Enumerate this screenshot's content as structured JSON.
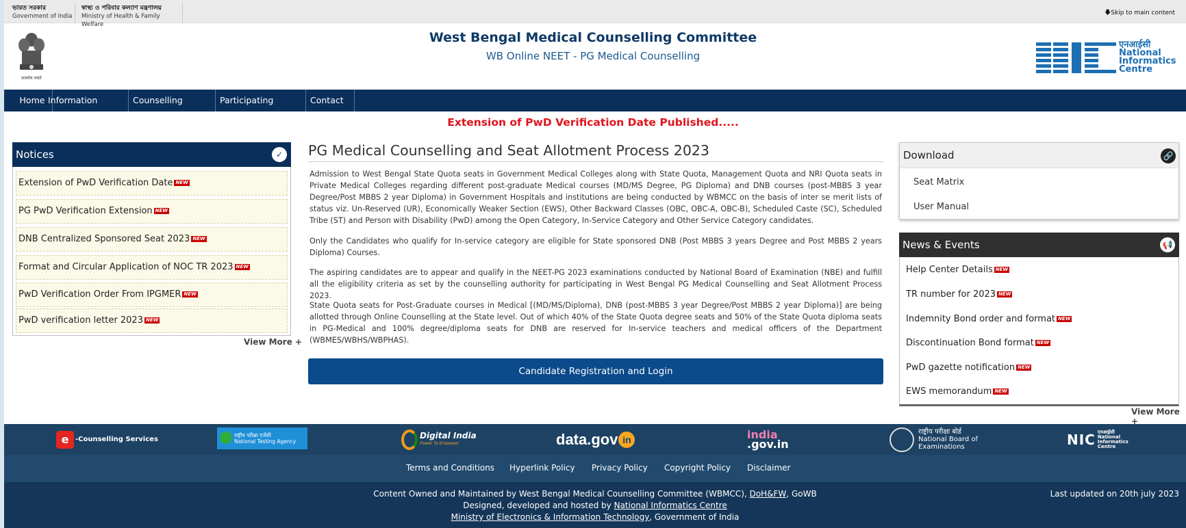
{
  "gov_bar": {
    "gov_hindi": "ভারত সরকার",
    "gov_english": "Government of India",
    "ministry_hindi": "স্বাস্থ্য ও পরিবার কল্যাণ মন্ত্রণালয়",
    "ministry_english": "Ministry of Health & Family Welfare",
    "skip_link": "Skip to main content"
  },
  "header": {
    "title": "West Bengal Medical Counselling Committee",
    "subtitle": "WB Online NEET - PG Medical Counselling",
    "emblem_caption": "सत्यमेव जयते",
    "nic_hindi": "एनआईसी",
    "nic_lines": [
      "National",
      "Informatics",
      "Centre"
    ]
  },
  "nav": {
    "items": [
      "Home",
      "Information Bulletin",
      "Counselling Schedule",
      "Participating Institutes",
      "Contact Us"
    ]
  },
  "marquee": "Extension of PwD Verification Date Published.....",
  "notices": {
    "title": "Notices",
    "new_label": "NEW",
    "items": [
      "Extension of PwD Verification Date",
      "PG PwD Verification Extension",
      "DNB Centralized Sponsored Seat 2023",
      "Format and Circular Application of NOC TR 2023",
      "PwD Verification Order From IPGMER",
      "PwD verification letter 2023"
    ],
    "view_more": "View More +"
  },
  "main": {
    "title": "PG Medical Counselling and Seat Allotment Process 2023",
    "paragraphs": [
      "Admission to West Bengal State Quota seats in Government Medical Colleges along with State Quota, Management Quota and NRI Quota seats in Private Medical Colleges regarding different post-graduate Medical courses (MD/MS Degree, PG Diploma) and DNB courses (post-MBBS 3 year Degree/Post MBBS 2 year Diploma) in Government Hospitals and institutions are being conducted by WBMCC on the basis of inter se merit lists of status viz. Un-Reserved (UR), Economically Weaker Section (EWS), Other Backward Classes (OBC, OBC-A, OBC-B), Scheduled Caste (SC), Scheduled Tribe (ST) and Person with Disability (PwD) among the Open Category, In-Service Category and Other Service Category candidates.",
      "Only the Candidates who qualify for In-service category are eligible for State sponsored DNB (Post MBBS 3 years Degree and Post MBBS 2 years Diploma) Courses.",
      "The aspiring candidates are to appear and qualify in the NEET-PG 2023 examinations conducted by National Board of Examination (NBE) and fulfill all the eligibility criteria as set by the counselling authority for participating in West Bengal PG Medical Counselling and Seat Allotment Process 2023.",
      "State Quota seats for Post-Graduate courses in Medical [(MD/MS/Diploma), DNB (post-MBBS 3 year Degree/Post MBBS 2 year Diploma)] are being allotted through Online Counselling at the State level. Out of which 40% of the State Quota degree seats and 50% of the State Quota diploma seats in PG-Medical and 100% degree/diploma seats for DNB are reserved for In-service teachers and medical officers of the Department (WBMES/WBHS/WBPHAS)."
    ],
    "cta": "Candidate Registration and Login"
  },
  "download": {
    "title": "Download",
    "items": [
      "Seat Matrix",
      "User Manual"
    ]
  },
  "news": {
    "title": "News & Events",
    "items": [
      "Help Center Details",
      "TR number for 2023",
      "Indemnity Bond order and format",
      "Discontinuation Bond format",
      "PwD gazette notification",
      "EWS memorandum"
    ],
    "view_more": "View More +"
  },
  "logos": {
    "ecounselling": "-Counselling Services",
    "ecounselling_letter": "e",
    "nta_hindi": "राष्ट्रीय परीक्षा एजेंसी",
    "nta": "National Testing Agency",
    "digital_india": "Digital India",
    "digital_india_tag": "Power To Empower",
    "data_gov": "data.gov",
    "data_gov_in": "in",
    "india_gov_top": "india",
    "india_gov_bottom": ".gov.in",
    "nbe_hindi": "राष्ट्रीय परीक्षा बोर्ड",
    "nbe_line1": "National Board of",
    "nbe_line2": "Examinations",
    "nic": "NIC",
    "nic_small_hindi": "एनआईसी",
    "nic_small": [
      "National",
      "Informatics",
      "Centre"
    ]
  },
  "footer": {
    "links": [
      "Terms and Conditions",
      "Hyperlink Policy",
      "Privacy Policy",
      "Copyright Policy",
      "Disclaimer"
    ],
    "line1_pre": "Content Owned and Maintained by West Bengal Medical Counselling Committee (WBMCC),",
    "line1_link": "DoH&FW",
    "line1_post": ", GoWB",
    "line2_pre": "Designed, developed and hosted by",
    "line2_link": "National Informatics Centre",
    "line3_link": "Ministry of Electronics & Information Technology",
    "line3_post": ", Government of India",
    "last_updated": "Last updated on 20th july 2023"
  },
  "colors": {
    "navy": "#0b2f5b",
    "cta_blue": "#0b4a8b",
    "marquee_red": "#e0141d",
    "notice_bg": "#fbf9e7"
  }
}
